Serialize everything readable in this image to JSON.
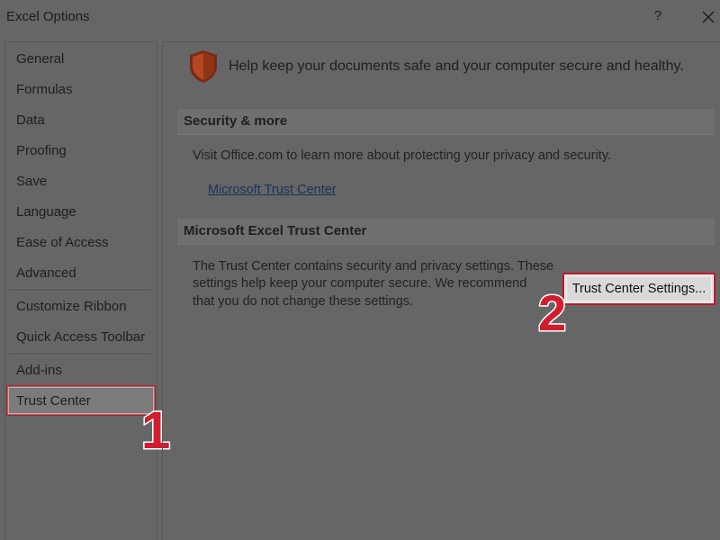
{
  "window": {
    "title": "Excel Options",
    "help_label": "?"
  },
  "sidebar": {
    "items": [
      {
        "label": "General"
      },
      {
        "label": "Formulas"
      },
      {
        "label": "Data"
      },
      {
        "label": "Proofing"
      },
      {
        "label": "Save"
      },
      {
        "label": "Language"
      },
      {
        "label": "Ease of Access"
      },
      {
        "label": "Advanced"
      },
      {
        "label": "Customize Ribbon"
      },
      {
        "label": "Quick Access Toolbar"
      },
      {
        "label": "Add-ins"
      },
      {
        "label": "Trust Center"
      }
    ],
    "selected": "Trust Center"
  },
  "main": {
    "heading": "Help keep your documents safe and your computer secure and healthy.",
    "security": {
      "title": "Security & more",
      "text": "Visit Office.com to learn more about protecting your privacy and security.",
      "link": "Microsoft Trust Center"
    },
    "trust_center": {
      "title": "Microsoft Excel Trust Center",
      "line1": "The Trust Center contains security and privacy settings. These",
      "line2": "settings help keep your computer secure. We recommend",
      "line3": "that you do not change these settings.",
      "button": "Trust Center Settings..."
    }
  },
  "annotations": {
    "step1": "1",
    "step2": "2",
    "highlight_color": "#c4152b",
    "badge_color": "#d11d2e"
  },
  "colors": {
    "background": "#666666",
    "shield": "#b5481f"
  }
}
